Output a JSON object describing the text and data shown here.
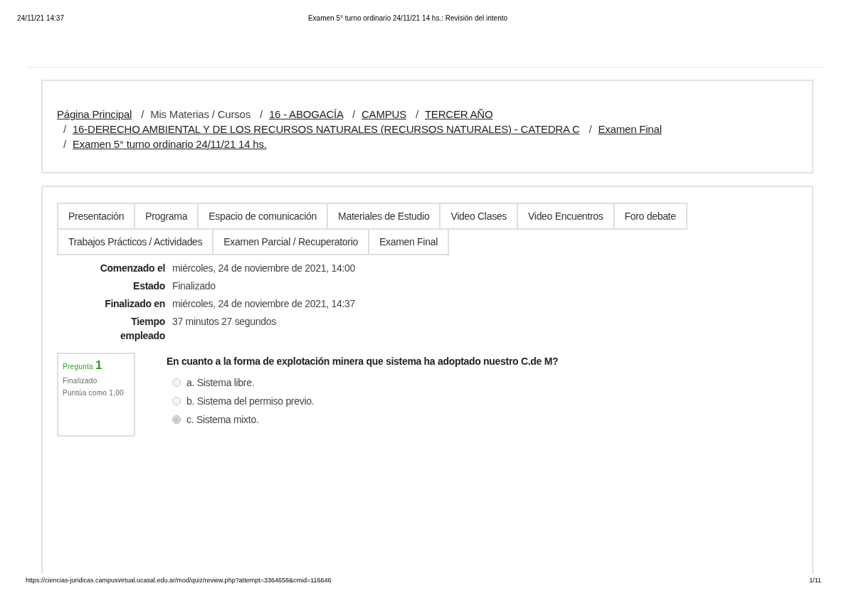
{
  "print_header": {
    "date": "24/11/21 14:37",
    "title": "Examen 5° turno ordinario 24/11/21 14 hs.: Revisión del intento"
  },
  "breadcrumb": [
    {
      "label": "Página Principal",
      "link": true
    },
    {
      "separator": "/",
      "label": "Mis Materias / Cursos",
      "link": false
    },
    {
      "separator": "/",
      "label": "16 - ABOGACÍA",
      "link": true
    },
    {
      "separator": "/",
      "label": "CAMPUS",
      "link": true
    },
    {
      "separator": "/",
      "label": "TERCER AÑO",
      "link": true
    },
    {
      "separator": "/",
      "label": "16-DERECHO AMBIENTAL Y DE LOS RECURSOS NATURALES (RECURSOS NATURALES) - CATEDRA C",
      "link": true
    },
    {
      "separator": "/",
      "label": "Examen Final",
      "link": true
    },
    {
      "separator": "/",
      "label": "Examen 5° turno ordinario 24/11/21 14 hs.",
      "link": true
    }
  ],
  "tabs": [
    {
      "label": "Presentación",
      "selected": false
    },
    {
      "label": "Programa",
      "selected": false
    },
    {
      "label": "Espacio de comunicación",
      "selected": false
    },
    {
      "label": "Materiales de Estudio",
      "selected": false
    },
    {
      "label": "Video Clases",
      "selected": false
    },
    {
      "label": "Video Encuentros",
      "selected": false
    },
    {
      "label": "Foro debate",
      "selected": false
    },
    {
      "label": "Trabajos Prácticos / Actividades",
      "selected": false
    },
    {
      "label": "Examen Parcial / Recuperatorio",
      "selected": false
    },
    {
      "label": "Examen Final",
      "selected": false
    }
  ],
  "summary": [
    {
      "label": "Comenzado el",
      "value": "miércoles, 24 de noviembre de 2021, 14:00"
    },
    {
      "label": "Estado",
      "value": "Finalizado"
    },
    {
      "label": "Finalizado en",
      "value": "miércoles, 24 de noviembre de 2021, 14:37"
    },
    {
      "label": "Tiempo empleado",
      "value": "37 minutos 27 segundos"
    }
  ],
  "question": {
    "heading": "Pregunta",
    "number": "1",
    "state": "Finalizado",
    "grade": "Puntúa como 1,00",
    "text": "En cuanto a la forma de explotación minera que sistema ha adoptado nuestro C.de M?",
    "options": [
      {
        "label": "a. Sistema libre.",
        "selected": false
      },
      {
        "label": "b. Sistema del permiso previo.",
        "selected": false
      },
      {
        "label": "c. Sistema mixto.",
        "selected": true
      }
    ]
  },
  "print_footer": {
    "url": "https://ciencias-juridicas.campusvirtual.ucasal.edu.ar/mod/quiz/review.php?attempt=3364658&cmid=116646",
    "page": "1/11"
  }
}
